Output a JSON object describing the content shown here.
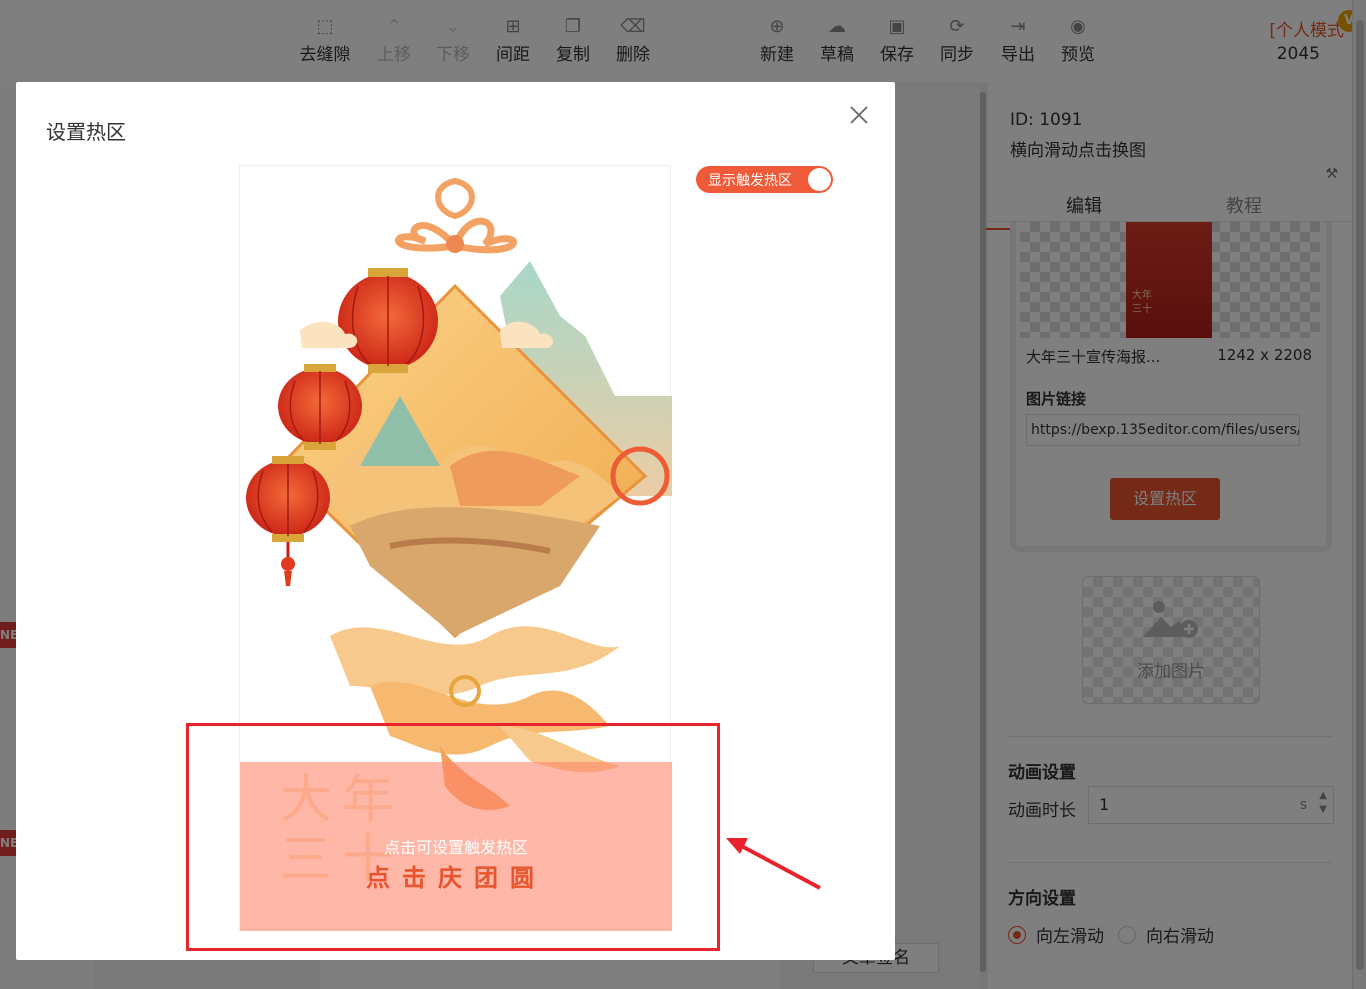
{
  "toolbar": {
    "left_buttons": [
      {
        "label": "去缝隙",
        "icon": "remove-gap-icon",
        "glyph": "⬚"
      },
      {
        "label": "上移",
        "icon": "move-up-icon",
        "glyph": "⌃"
      },
      {
        "label": "下移",
        "icon": "move-down-icon",
        "glyph": "⌄"
      },
      {
        "label": "间距",
        "icon": "spacing-icon",
        "glyph": "⊞"
      },
      {
        "label": "复制",
        "icon": "copy-icon",
        "glyph": "❐"
      },
      {
        "label": "删除",
        "icon": "trash-icon",
        "glyph": "🗑"
      }
    ],
    "right_buttons": [
      {
        "label": "新建",
        "icon": "new-file-icon",
        "glyph": "🗋"
      },
      {
        "label": "草稿",
        "icon": "cloud-icon",
        "glyph": "☁"
      },
      {
        "label": "保存",
        "icon": "save-icon",
        "glyph": "🖫"
      },
      {
        "label": "同步",
        "icon": "sync-icon",
        "glyph": "⟳"
      },
      {
        "label": "导出",
        "icon": "export-icon",
        "glyph": "⇥"
      },
      {
        "label": "预览",
        "icon": "eye-icon",
        "glyph": "◉"
      }
    ],
    "mode_label": "[个人模式",
    "mode_number": "2045",
    "vip_badge": "V"
  },
  "left_strip": {
    "new_tag": "NE"
  },
  "canvas": {
    "sign_button": "文章签名"
  },
  "right_panel": {
    "id": "ID: 1091",
    "component_name": "横向滑动点击换图",
    "tools_icon": "⚒",
    "tabs": [
      "编辑",
      "教程"
    ],
    "image": {
      "thumb_text_1": "大年",
      "thumb_text_2": "三十",
      "name": "大年三十宣传海报...",
      "size": "1242 x 2208",
      "link_label": "图片链接",
      "link_value": "https://bexp.135editor.com/files/users/0/",
      "hotzone_button": "设置热区"
    },
    "add_image_label": "添加图片",
    "animation": {
      "section_title": "动画设置",
      "duration_label": "动画时长",
      "duration_value": "1",
      "duration_unit": "s"
    },
    "direction": {
      "section_title": "方向设置",
      "options": [
        "向左滑动",
        "向右滑动"
      ],
      "selected": "向左滑动"
    }
  },
  "modal": {
    "title": "设置热区",
    "toggle_label": "显示触发热区",
    "toggle_on": true,
    "poster": {
      "ghost_title_line1": "大年",
      "ghost_title_line2": "三十",
      "hotzone_hint": "点击可设置触发热区",
      "hotzone_text": "点击庆团圆"
    }
  },
  "colors": {
    "accent": "#e8542d",
    "hotzone_fill": "#ffa590",
    "annotation_red": "#e8232e",
    "lantern_red": "#e23a1f",
    "gold": "#f5b548"
  }
}
